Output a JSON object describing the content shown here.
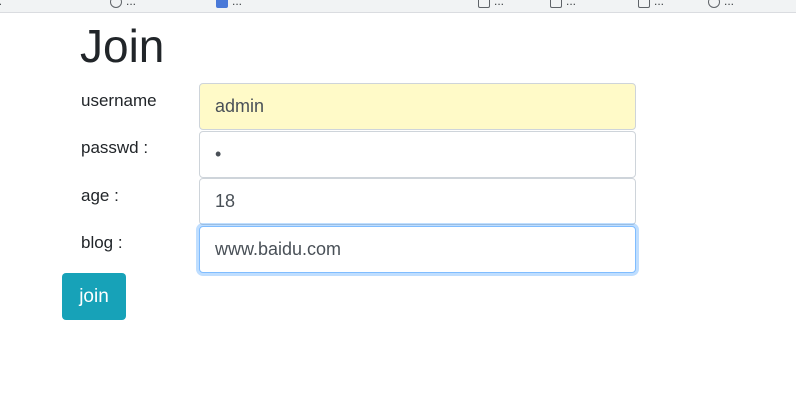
{
  "browser": {
    "bookmarks": [
      {
        "label": "...",
        "icon": "globe-icon"
      },
      {
        "label": "...",
        "icon": "globe-icon"
      },
      {
        "label": "...",
        "icon": "bookmark-icon"
      },
      {
        "label": "...",
        "icon": "folder-icon"
      },
      {
        "label": "...",
        "icon": "folder-icon"
      },
      {
        "label": "...",
        "icon": "folder-icon"
      },
      {
        "label": "...",
        "icon": "globe-icon"
      }
    ]
  },
  "page": {
    "title": "Join"
  },
  "form": {
    "fields": [
      {
        "name": "username",
        "label": "username",
        "value": "admin",
        "type": "text",
        "state": "autofilled"
      },
      {
        "name": "passwd",
        "label": "passwd :",
        "value": "1",
        "type": "password",
        "state": "default"
      },
      {
        "name": "age",
        "label": "age :",
        "value": "18",
        "type": "text",
        "state": "default"
      },
      {
        "name": "blog",
        "label": "blog :",
        "value": "www.baidu.com",
        "type": "text",
        "state": "focused"
      }
    ],
    "submit_label": "join"
  },
  "colors": {
    "button_bg": "#17a2b8",
    "autofill_bg": "#fffac8",
    "focus_border": "#80bdff",
    "input_border": "#ced4da"
  }
}
